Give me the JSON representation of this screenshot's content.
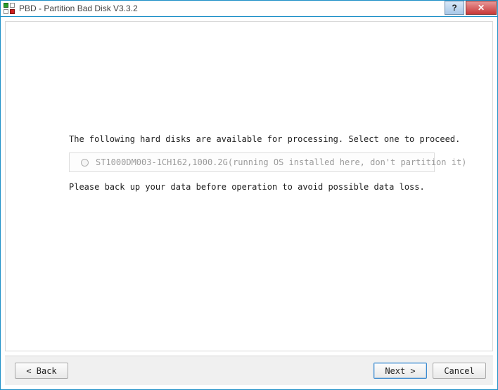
{
  "window": {
    "title": "PBD - Partition Bad Disk V3.3.2",
    "help_label": "?",
    "close_label": "✕"
  },
  "main": {
    "instruction": "The following hard disks are available for processing. Select one to proceed.",
    "disks": [
      {
        "label": "ST1000DM003-1CH162,1000.2G(running OS installed here, don't partition it)"
      }
    ],
    "warning": "Please back up your data before operation to avoid possible data loss."
  },
  "buttons": {
    "back": "< Back",
    "next": "Next >",
    "cancel": "Cancel"
  }
}
